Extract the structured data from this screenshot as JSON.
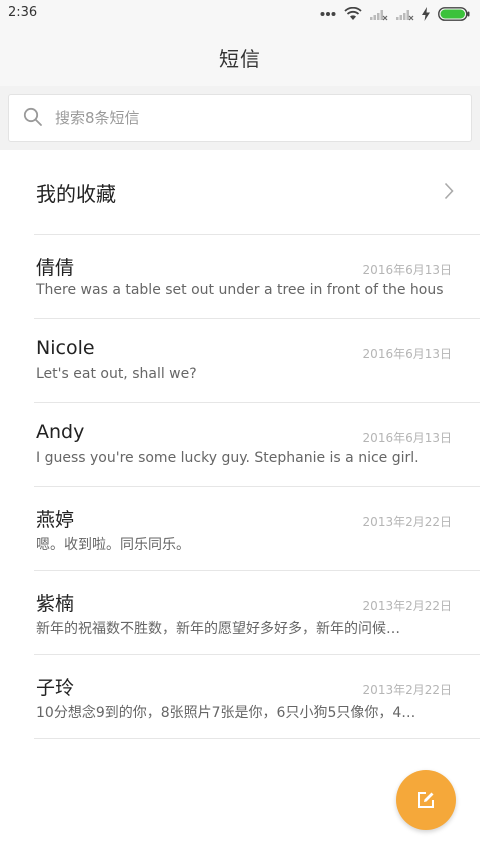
{
  "status_bar": {
    "time": "2:36",
    "icons": [
      "more-icon",
      "wifi-icon",
      "signal-icon",
      "signal-icon",
      "charging-icon",
      "battery-icon"
    ],
    "battery_color": "#3cc23c"
  },
  "header": {
    "title": "短信"
  },
  "search": {
    "placeholder": "搜索8条短信"
  },
  "favorites": {
    "label": "我的收藏"
  },
  "messages": [
    {
      "name": "倩倩",
      "date": "2016年6月13日",
      "preview": "There was a table set out under a tree in front of the hous"
    },
    {
      "name": "Nicole",
      "date": "2016年6月13日",
      "preview": "Let's eat out, shall we?"
    },
    {
      "name": "Andy",
      "date": "2016年6月13日",
      "preview": "I guess you're some lucky guy. Stephanie is a nice girl."
    },
    {
      "name": "燕婷",
      "date": "2013年2月22日",
      "preview": "嗯。收到啦。同乐同乐。"
    },
    {
      "name": "紫楠",
      "date": "2013年2月22日",
      "preview": "新年的祝福数不胜数，新年的愿望好多好多，新年的问候…"
    },
    {
      "name": "子玲",
      "date": "2013年2月22日",
      "preview": "10分想念9到的你，8张照片7张是你，6只小狗5只像你，4…"
    }
  ],
  "fab": {
    "icon": "compose-icon",
    "color": "#f5a83a"
  }
}
